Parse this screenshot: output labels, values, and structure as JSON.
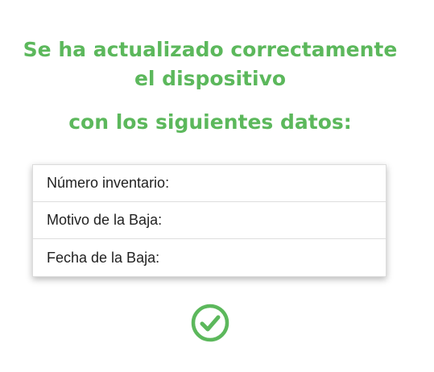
{
  "message": {
    "line1": "Se ha actualizado correctamente",
    "line2": "el dispositivo",
    "line3": "con los siguientes datos:"
  },
  "details": [
    {
      "label": "Número inventario:",
      "value": ""
    },
    {
      "label": "Motivo de la Baja:",
      "value": ""
    },
    {
      "label": "Fecha de la Baja:",
      "value": ""
    }
  ],
  "colors": {
    "accent": "#5cb85c",
    "text": "#222222"
  },
  "icons": {
    "status": "check-circle-icon"
  }
}
